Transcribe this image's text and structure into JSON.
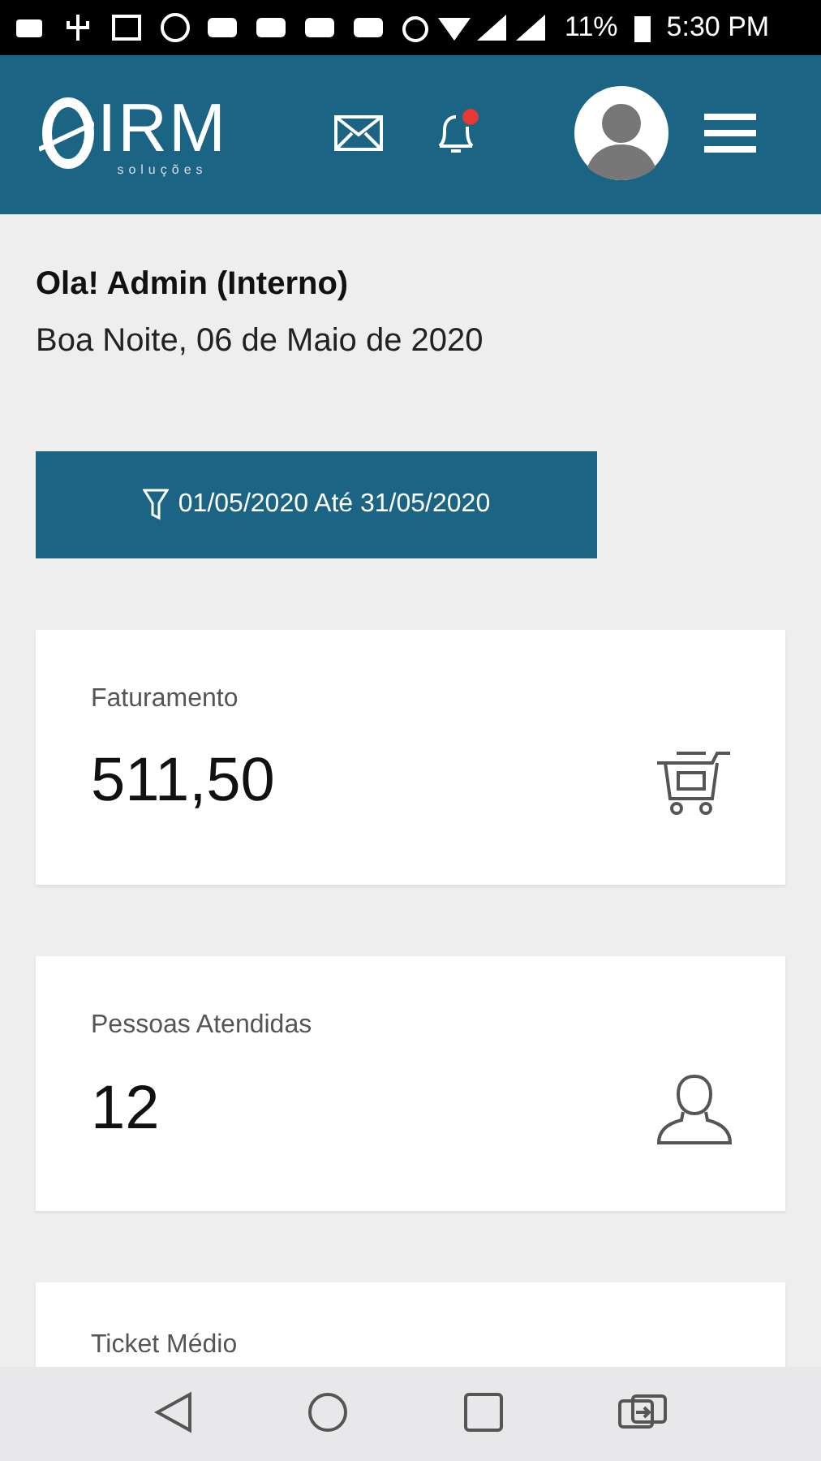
{
  "status_bar": {
    "battery": "11%",
    "time": "5:30 PM"
  },
  "header": {
    "logo": {
      "name": "IRM",
      "tagline": "soluções"
    },
    "notifications": {
      "unread": true
    }
  },
  "greeting": {
    "title": "Ola! Admin (Interno)",
    "subtitle": "Boa Noite, 06 de Maio de 2020"
  },
  "filter_button": {
    "label": "01/05/2020 Até 31/05/2020"
  },
  "metrics": [
    {
      "label": "Faturamento",
      "value": "511,50",
      "kind": "cart"
    },
    {
      "label": "Pessoas Atendidas",
      "value": "12",
      "kind": "person"
    },
    {
      "label": "Ticket Médio",
      "kind": "none"
    }
  ]
}
